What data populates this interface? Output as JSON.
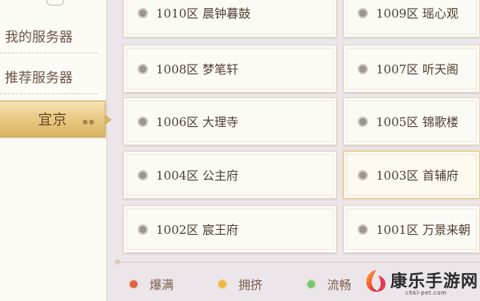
{
  "sidebar": {
    "items": [
      {
        "label": "我的服务器"
      },
      {
        "label": "推荐服务器"
      },
      {
        "label": "宜京",
        "active": true
      }
    ]
  },
  "servers": [
    {
      "label": "1010区 晨钟暮鼓",
      "status": "maintenance"
    },
    {
      "label": "1009区 瑶心观",
      "status": "maintenance"
    },
    {
      "label": "1008区 梦笔轩",
      "status": "maintenance"
    },
    {
      "label": "1007区 听天阁",
      "status": "maintenance"
    },
    {
      "label": "1006区 大理寺",
      "status": "maintenance"
    },
    {
      "label": "1005区 锦歌楼",
      "status": "maintenance"
    },
    {
      "label": "1004区 公主府",
      "status": "maintenance"
    },
    {
      "label": "1003区 首辅府",
      "status": "maintenance",
      "selected": true
    },
    {
      "label": "1002区 宸王府",
      "status": "maintenance"
    },
    {
      "label": "1001区 万景来朝",
      "status": "maintenance"
    }
  ],
  "legend": [
    {
      "label": "爆满",
      "color": "#e0623e"
    },
    {
      "label": "拥挤",
      "color": "#eeb83c"
    },
    {
      "label": "流畅",
      "color": "#73c86a"
    }
  ],
  "status_colors": {
    "maintenance": "#9c958f"
  },
  "watermark": {
    "title": "康乐手游网",
    "subtitle": "chkl-pet.com"
  }
}
